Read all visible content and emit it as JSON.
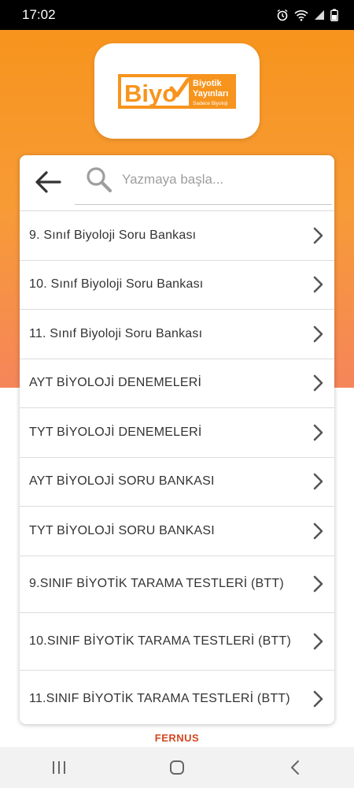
{
  "status_bar": {
    "time": "17:02",
    "icons": [
      "alarm-icon",
      "wifi-icon",
      "signal-icon",
      "battery-icon"
    ]
  },
  "logo": {
    "brand": "Biyo",
    "line1": "Biyotik",
    "line2": "Yayınları",
    "tagline": "Sadece Biyoloji"
  },
  "search": {
    "placeholder": "Yazmaya başla...",
    "value": ""
  },
  "list": {
    "items": [
      {
        "label": "9. Sınıf Biyoloji Soru Bankası"
      },
      {
        "label": "10. Sınıf Biyoloji Soru Bankası"
      },
      {
        "label": "11. Sınıf Biyoloji Soru Bankası"
      },
      {
        "label": "AYT BİYOLOJİ DENEMELERİ"
      },
      {
        "label": "TYT BİYOLOJİ DENEMELERİ"
      },
      {
        "label": "AYT BİYOLOJİ SORU BANKASI"
      },
      {
        "label": "TYT BİYOLOJİ SORU BANKASI"
      },
      {
        "label": "9.SINIF BİYOTİK TARAMA TESTLERİ (BTT)"
      },
      {
        "label": "10.SINIF BİYOTİK TARAMA TESTLERİ (BTT)"
      },
      {
        "label": "11.SINIF BİYOTİK TARAMA TESTLERİ (BTT)"
      }
    ]
  },
  "footer": {
    "brand": "FERNUS"
  },
  "colors": {
    "accent": "#f7941d",
    "footer_brand": "#d4471f"
  },
  "nav_bar": {
    "icons": [
      "recent-apps-icon",
      "home-icon",
      "back-icon"
    ]
  }
}
